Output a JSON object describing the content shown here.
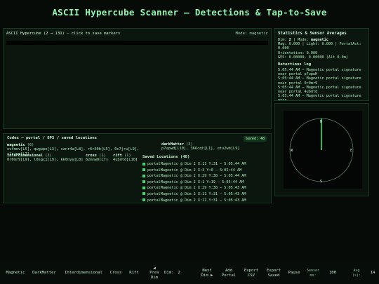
{
  "page": {
    "title": "ASCII Hypercube Scanner — Detections & Tap-to-Save"
  },
  "main": {
    "header": "ASCII Hypercube (2 → 13D) — click to save markers",
    "mode_text": "Mode: magnetic"
  },
  "stats": {
    "title": "Statistics & Sensor Averages",
    "dim_label": "Dim:",
    "dim_value": "2",
    "mode_label": "| Mode:",
    "mode_value": "magnetic",
    "mag_line": "Mag: 0.000 | Light: 0.000 | PortalAct:",
    "portal_line": "0.000",
    "orientation_line": "Orientation: 0.000",
    "gps_line": "GPS: 0.00000, 0.00000 (Alt 0.0m)",
    "log_title": "Detections log",
    "log": [
      "5:05:44 AM — Magnetic portal signature near portal p7upwH",
      "5:05:44 AM — Magnetic portal signature near portal 0r0mr9",
      "5:05:44 AM — Magnetic portal signature near portal 4ubdtd",
      "5:05:44 AM — Magnetic portal signature near"
    ]
  },
  "compass": {
    "n": "N",
    "e": "E",
    "s": "S",
    "w": "W",
    "heading_deg": 0
  },
  "codex": {
    "title": "Codex — portal / GPS / saved locations",
    "saved_badge": "Saved: 48",
    "groups": {
      "magnetic": {
        "name": "magnetic",
        "count": "(6)",
        "items": "xvfmov[L5], qwgwpo[L3], vznr4a[L8], r6r50b[L5], 0c7jrw[L9], slrzpm[L7]"
      },
      "darkmatter": {
        "name": "darkMatter",
        "count": "(3)",
        "items": "p7upwH[L10], 366cqt[L1], etv2wb[L9]"
      },
      "interdimensional": {
        "name": "interdimensional",
        "count": "(3)",
        "items": "0r0mr9[L9], l0sgc1[L9], kk0nyy[L0]"
      },
      "cross": {
        "name": "cross",
        "count": "(1)",
        "items": "6zmnw0[L7]"
      },
      "rift": {
        "name": "rift",
        "count": "(1)",
        "items": "4ubdtd[L10]"
      }
    },
    "saved_title": "Saved Locations (48)",
    "saved": [
      "portalMagnetic @ Dim 2 X:11 Y:31 — 5:05:44 AM",
      "portalMagnetic @ Dim 2 X:3 Y:0 — 5:05:44 AM",
      "portalMagnetic @ Dim 2 X:29 Y:38 — 5:05:44 AM",
      "portalMagnetic @ Dim 2 X:1 Y:19 — 5:05:44 AM",
      "portalMagnetic @ Dim 2 X:29 Y:38 — 5:05:43 AM",
      "portalMagnetic @ Dim 2 X:11 Y:31 — 5:05:43 AM",
      "portalMagnetic @ Dim 2 X:11 Y:31 — 5:05:43 AM"
    ]
  },
  "toolbar": {
    "magnetic": "Magnetic",
    "darkmatter": "DarkMatter",
    "interdimensional": "Interdimensional",
    "cross": "Cross",
    "rift": "Rift",
    "prev_dim": [
      "◀",
      "Prev",
      "Dim"
    ],
    "dim_label": "Dim:",
    "dim_value": "2",
    "next_dim": [
      "Next",
      "Dim ▶"
    ],
    "add_portal": [
      "Add",
      "Portal"
    ],
    "export_csv": [
      "Export",
      "CSV"
    ],
    "export_saved": [
      "Export",
      "Saved"
    ],
    "pause": "Pause",
    "sensor_label": [
      "Sensor",
      "ms:"
    ],
    "sensor_value": "100",
    "avg_label": [
      "Avg",
      "(s):"
    ],
    "avg_value": "14"
  }
}
